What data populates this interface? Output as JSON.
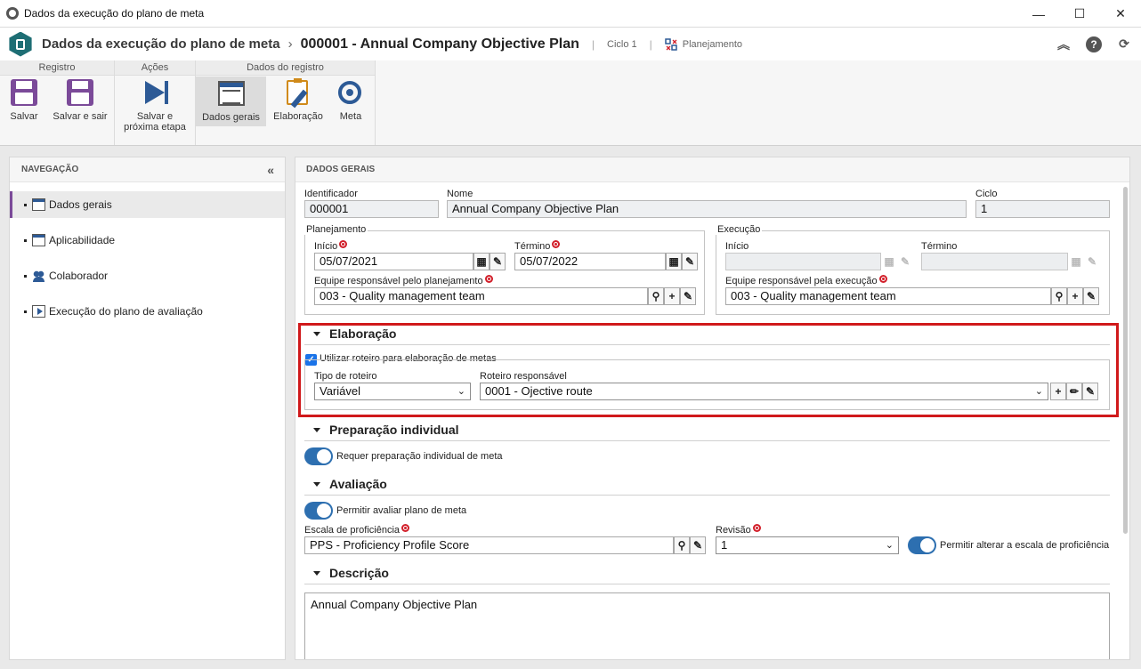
{
  "window": {
    "title": "Dados da execução do plano de meta",
    "minimize": "—",
    "maximize": "☐",
    "close": "✕"
  },
  "header": {
    "module": "Dados da execução do plano de meta",
    "separator": "›",
    "record": "000001 - Annual Company Objective Plan",
    "cycle": "Ciclo 1",
    "status": "Planejamento",
    "bar": "|"
  },
  "ribbon": {
    "groups": [
      {
        "title": "Registro"
      },
      {
        "title": "Ações"
      },
      {
        "title": "Dados do registro"
      }
    ],
    "buttons": {
      "save": "Salvar",
      "save_exit": "Salvar e sair",
      "save_next_1": "Salvar e",
      "save_next_2": "próxima etapa",
      "general_data": "Dados gerais",
      "elaboration": "Elaboração",
      "goal": "Meta"
    }
  },
  "nav": {
    "title": "NAVEGAÇÃO",
    "collapse": "«",
    "items": [
      {
        "label": "Dados gerais",
        "icon": "form-icon",
        "active": true
      },
      {
        "label": "Aplicabilidade",
        "icon": "applicability-icon"
      },
      {
        "label": "Colaborador",
        "icon": "people-icon"
      },
      {
        "label": "Execução do plano de avaliação",
        "icon": "execution-icon"
      }
    ]
  },
  "main": {
    "title": "DADOS GERAIS",
    "identifier_label": "Identificador",
    "identifier_value": "000001",
    "name_label": "Nome",
    "name_value": "Annual Company Objective Plan",
    "cycle_label": "Ciclo",
    "cycle_value": "1",
    "planning": {
      "legend": "Planejamento",
      "start_label": "Início",
      "start_value": "05/07/2021",
      "end_label": "Término",
      "end_value": "05/07/2022",
      "team_label": "Equipe responsável pelo planejamento",
      "team_value": "003 - Quality management team"
    },
    "execution": {
      "legend": "Execução",
      "start_label": "Início",
      "start_value": "",
      "end_label": "Término",
      "end_value": "",
      "team_label": "Equipe responsável pela execução",
      "team_value": "003 - Quality management team"
    },
    "elaboration": {
      "title": "Elaboração",
      "use_route_label": "Utilizar roteiro para elaboração de metas",
      "use_route_checked": true,
      "route_type_label": "Tipo de roteiro",
      "route_type_value": "Variável",
      "route_label": "Roteiro responsável",
      "route_value": "0001 - Ojective route"
    },
    "individual": {
      "title": "Preparação individual",
      "toggle_label": "Requer preparação individual de meta",
      "toggle_on": true
    },
    "evaluation": {
      "title": "Avaliação",
      "toggle_label": "Permitir avaliar plano de meta",
      "toggle_on": true,
      "scale_label": "Escala de proficiência",
      "scale_value": "PPS - Proficiency Profile Score",
      "revision_label": "Revisão",
      "revision_value": "1",
      "allow_change_label": "Permitir alterar a escala de proficiência",
      "allow_change_on": true
    },
    "description": {
      "title": "Descrição",
      "value": "Annual Company Objective Plan"
    }
  },
  "colors": {
    "accent": "#7b4a99",
    "highlight": "#d0191b",
    "toggle": "#2d6fb0",
    "required": "#d21f2a"
  }
}
